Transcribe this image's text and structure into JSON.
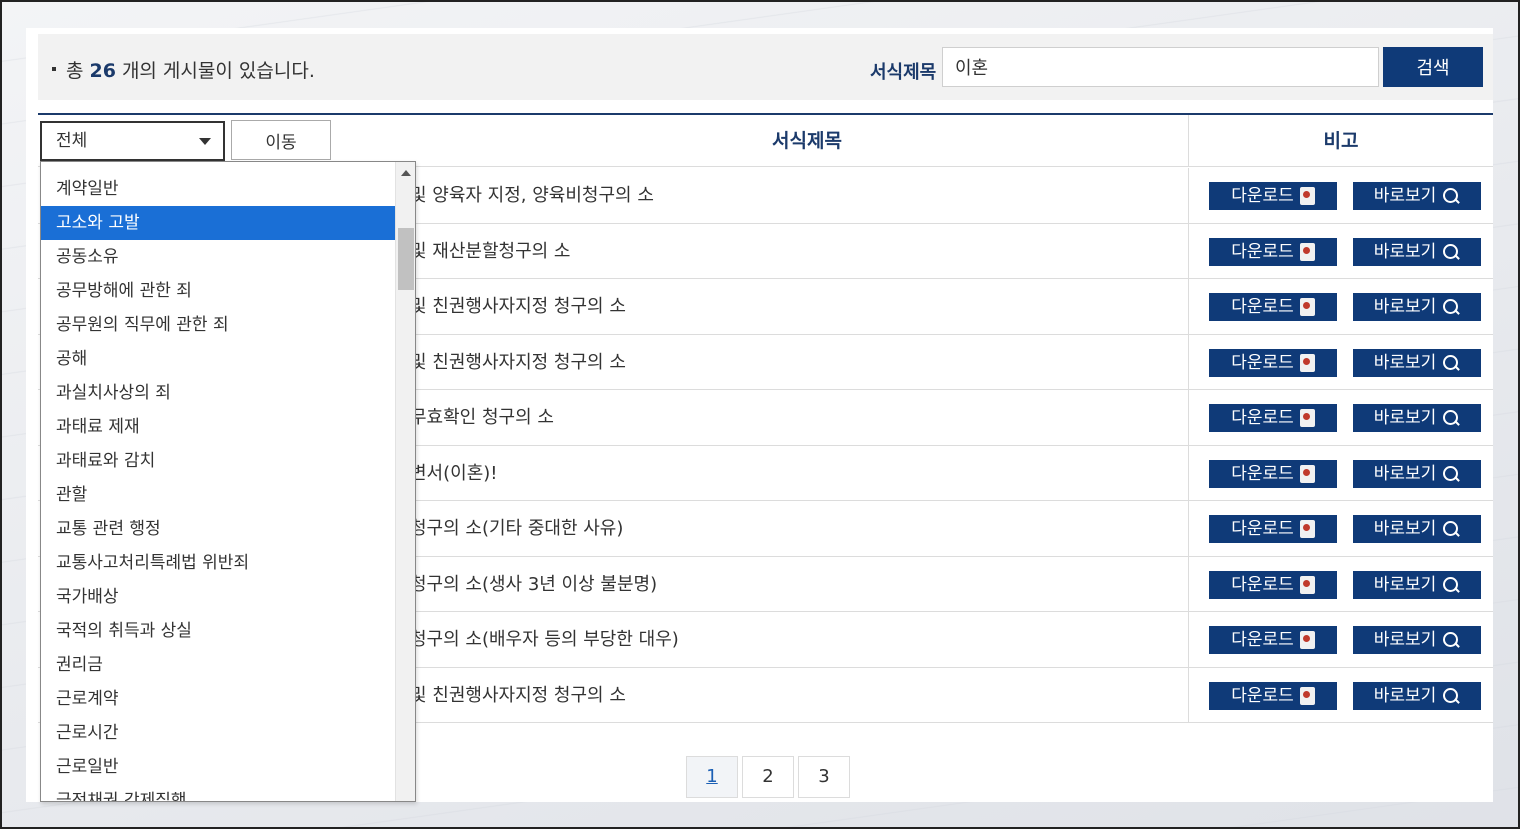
{
  "summary": {
    "prefix": "총",
    "count": "26",
    "suffix": "개의 게시물이 있습니다."
  },
  "search": {
    "label": "서식제목",
    "value": "이혼",
    "button": "검색"
  },
  "filter": {
    "selected": "전체",
    "move_button": "이동"
  },
  "table": {
    "headers": {
      "title": "서식제목",
      "note": "비고"
    },
    "download_label": "다운로드",
    "view_label": "바로보기",
    "rows": [
      {
        "title": "및 양육자 지정, 양육비청구의 소"
      },
      {
        "title": "및 재산분할청구의 소"
      },
      {
        "title": "및 친권행사자지정 청구의 소"
      },
      {
        "title": "및 친권행사자지정 청구의 소"
      },
      {
        "title": "무효확인 청구의 소"
      },
      {
        "title": "변서(이혼)!"
      },
      {
        "title": "청구의 소(기타 중대한 사유)"
      },
      {
        "title": "청구의 소(생사 3년 이상 불분명)"
      },
      {
        "title": "청구의 소(배우자 등의 부당한 대우)"
      },
      {
        "title": "및 친권행사자지정 청구의 소"
      }
    ]
  },
  "pagination": {
    "pages": [
      "1",
      "2",
      "3"
    ],
    "current": "1"
  },
  "dropdown": {
    "items": [
      "계약일반",
      "고소와 고발",
      "공동소유",
      "공무방해에 관한 죄",
      "공무원의 직무에 관한 죄",
      "공해",
      "과실치사상의 죄",
      "과태료 제재",
      "과태료와 감치",
      "관할",
      "교통 관련 행정",
      "교통사고처리특례법 위반죄",
      "국가배상",
      "국적의 취득과 상실",
      "권리금",
      "근로계약",
      "근로시간",
      "근로일반",
      "금전채권 강제집행"
    ],
    "selected_index": 1
  },
  "colors": {
    "primary": "#0f3a78",
    "header_text": "#1b3a6b",
    "dropdown_selected": "#1a6fd6"
  }
}
